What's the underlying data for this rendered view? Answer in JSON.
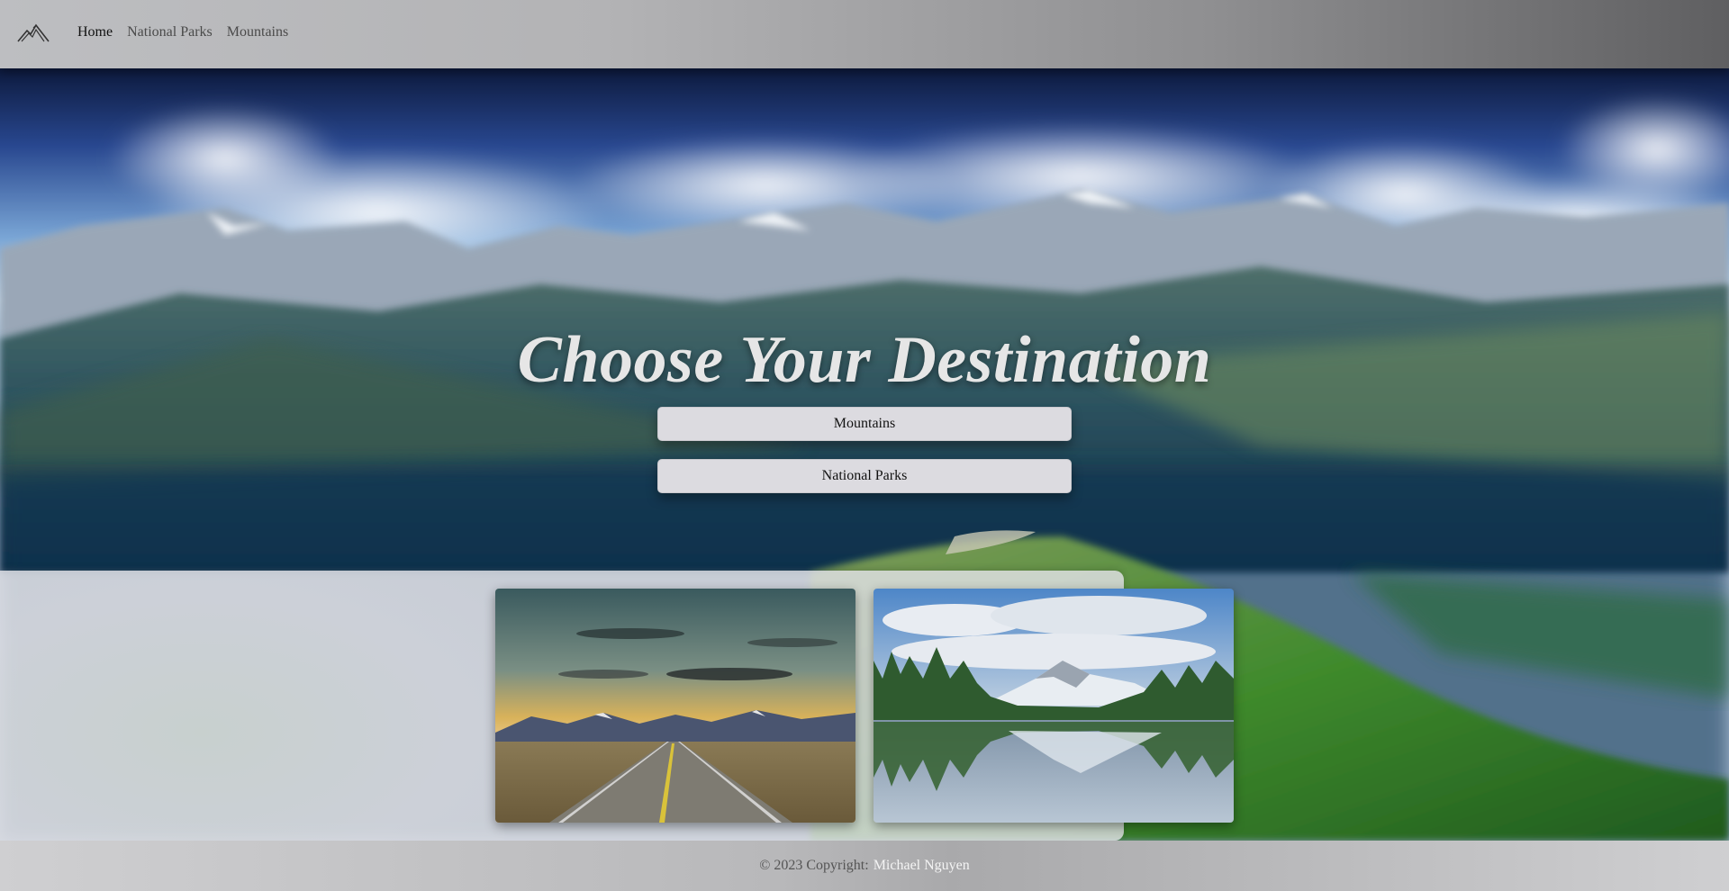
{
  "nav": {
    "logo": "mountain-logo-icon",
    "links": [
      {
        "label": "Home",
        "active": true
      },
      {
        "label": "National Parks",
        "active": false
      },
      {
        "label": "Mountains",
        "active": false
      }
    ]
  },
  "hero": {
    "title": "Choose Your Destination",
    "buttons": [
      {
        "label": "Mountains"
      },
      {
        "label": "National Parks"
      }
    ]
  },
  "cards": [
    {
      "image": "mountain-road-sunset-image"
    },
    {
      "image": "lake-mountain-reflection-image"
    }
  ],
  "footer": {
    "copyright": "© 2023 Copyright:",
    "author": "Michael Nguyen"
  },
  "colors": {
    "button_bg": "#dcdbe0",
    "title": "#e6e6e6",
    "footer_link": "#f4f4f4"
  }
}
